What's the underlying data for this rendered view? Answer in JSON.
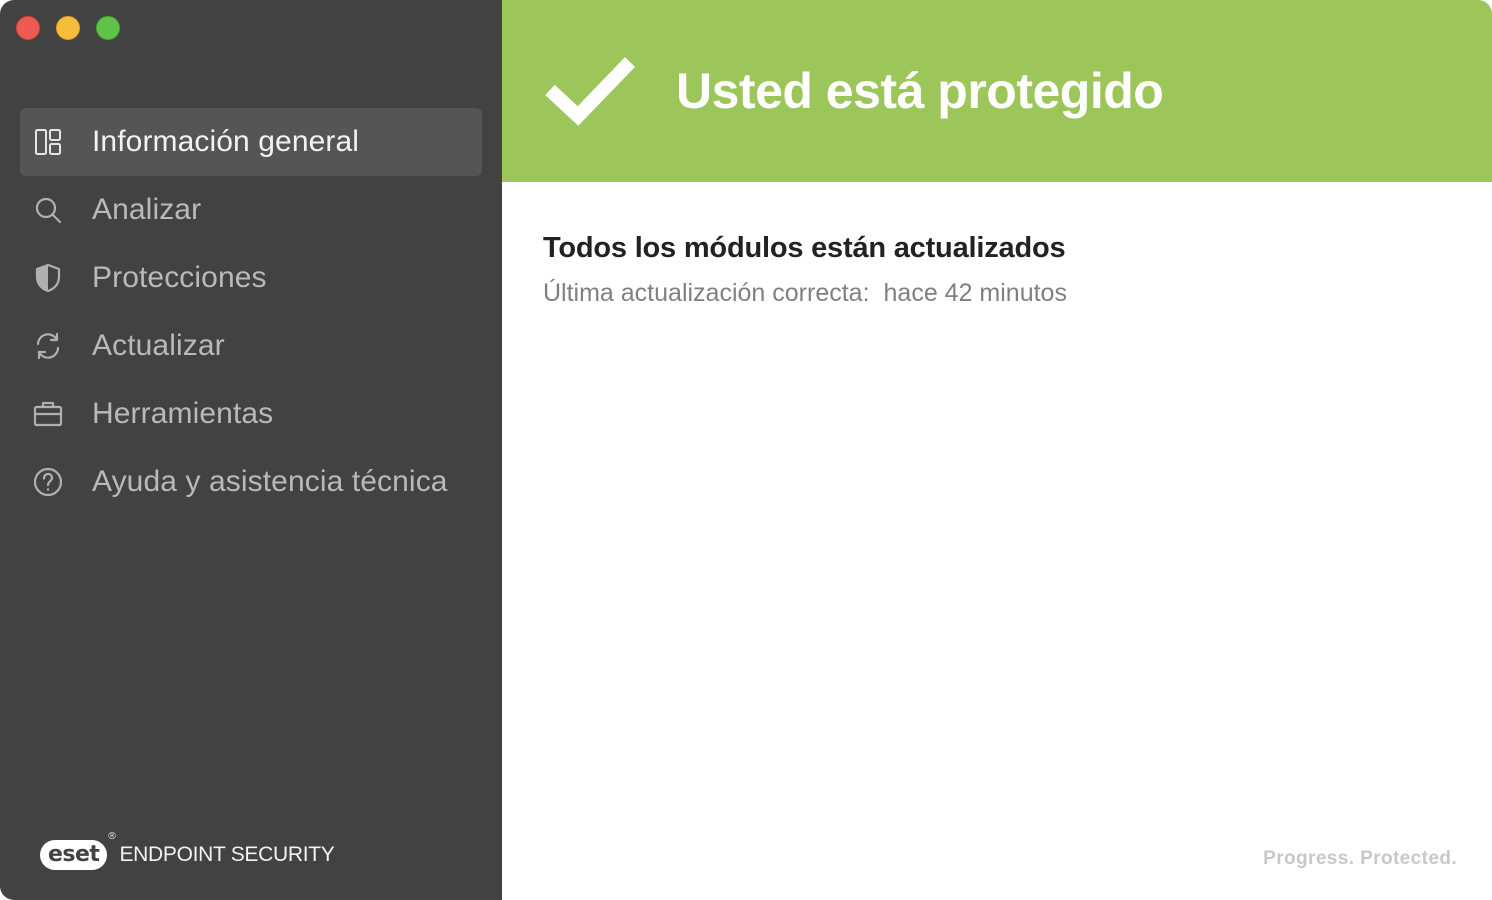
{
  "sidebar": {
    "items": [
      {
        "id": "overview",
        "label": "Información general",
        "icon": "overview-icon",
        "active": true
      },
      {
        "id": "scan",
        "label": "Analizar",
        "icon": "search-icon",
        "active": false
      },
      {
        "id": "protections",
        "label": "Protecciones",
        "icon": "shield-icon",
        "active": false
      },
      {
        "id": "update",
        "label": "Actualizar",
        "icon": "refresh-icon",
        "active": false
      },
      {
        "id": "tools",
        "label": "Herramientas",
        "icon": "briefcase-icon",
        "active": false
      },
      {
        "id": "help",
        "label": "Ayuda y asistencia técnica",
        "icon": "help-icon",
        "active": false
      }
    ],
    "brand": {
      "logo_text": "eset",
      "registered": "®",
      "product": "ENDPOINT SECURITY"
    }
  },
  "status": {
    "title": "Usted está protegido",
    "icon": "checkmark-icon",
    "color": "#9cc55a"
  },
  "modules": {
    "title": "Todos los módulos están actualizados",
    "last_update_label": "Última actualización correcta:",
    "last_update_value": "hace 42 minutos"
  },
  "footer": {
    "tagline": "Progress. Protected."
  },
  "colors": {
    "sidebar_bg": "#424242",
    "sidebar_active": "#555555",
    "accent_green": "#9cc55a"
  }
}
